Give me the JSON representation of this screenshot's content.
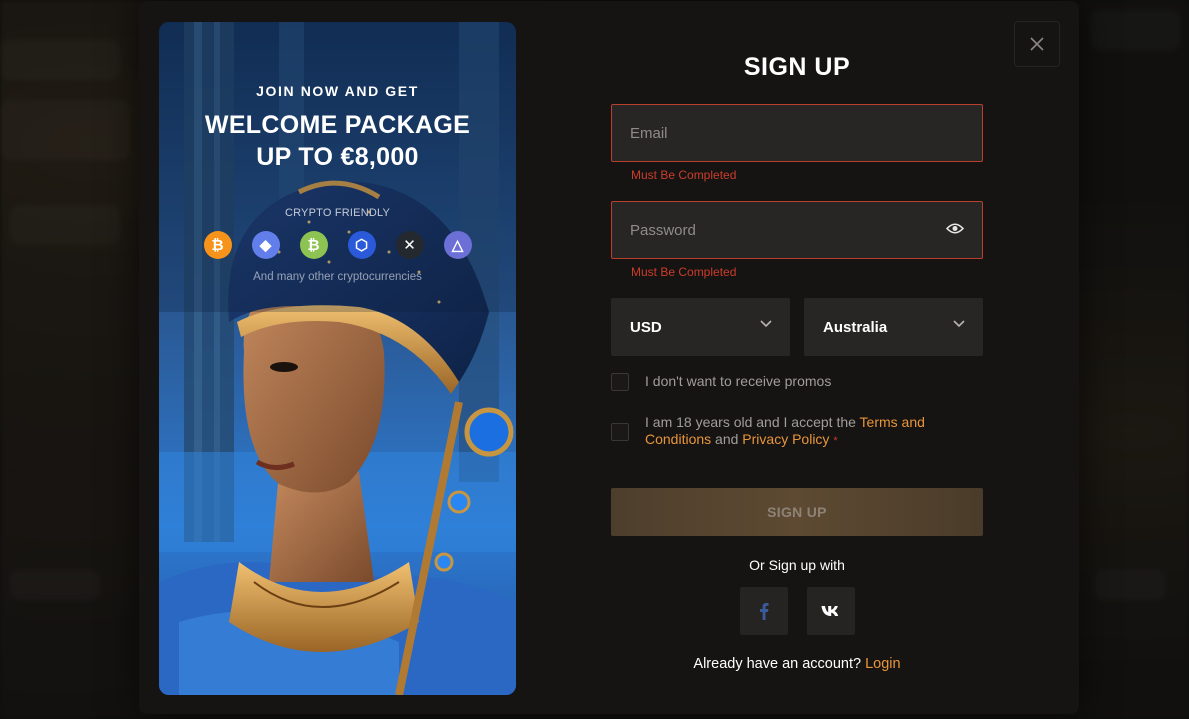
{
  "modal": {
    "close_label": "×"
  },
  "promo": {
    "join_text": "JOIN NOW AND GET",
    "headline_line1": "WELCOME PACKAGE",
    "headline_line2": "UP TO €8,000",
    "crypto_label": "CRYPTO FRIENDLY",
    "crypto_icons": [
      {
        "name": "bitcoin-icon",
        "glyph": "₿",
        "color": "#f7931a"
      },
      {
        "name": "ethereum-icon",
        "glyph": "◆",
        "color": "#627eea"
      },
      {
        "name": "bitcoin-cash-icon",
        "glyph": "₿",
        "color": "#8dc351"
      },
      {
        "name": "chainlink-icon",
        "glyph": "⬡",
        "color": "#2a5ada"
      },
      {
        "name": "xrp-icon",
        "glyph": "✕",
        "color": "#23292f"
      },
      {
        "name": "tron-icon",
        "glyph": "△",
        "color": "#6b6fd6"
      }
    ],
    "many_text": "And many other cryptocurrencies"
  },
  "form": {
    "title": "SIGN UP",
    "email_placeholder": "Email",
    "email_error": "Must Be Completed",
    "password_placeholder": "Password",
    "password_error": "Must Be Completed",
    "currency": "USD",
    "country": "Australia",
    "promo_checkbox_label": "I don't want to receive promos",
    "terms_prefix": "I am 18 years old and I accept the",
    "terms_link": "Terms and Conditions",
    "terms_and": "and",
    "privacy_link": "Privacy Policy",
    "required_mark": "*",
    "submit_label": "SIGN UP",
    "or_text": "Or Sign up with",
    "account_text": "Already have an account?",
    "login_link": "Login"
  },
  "colors": {
    "accent": "#e9953a",
    "error": "#cb3d2b",
    "modal_bg": "#151413",
    "field_bg": "#282625"
  }
}
